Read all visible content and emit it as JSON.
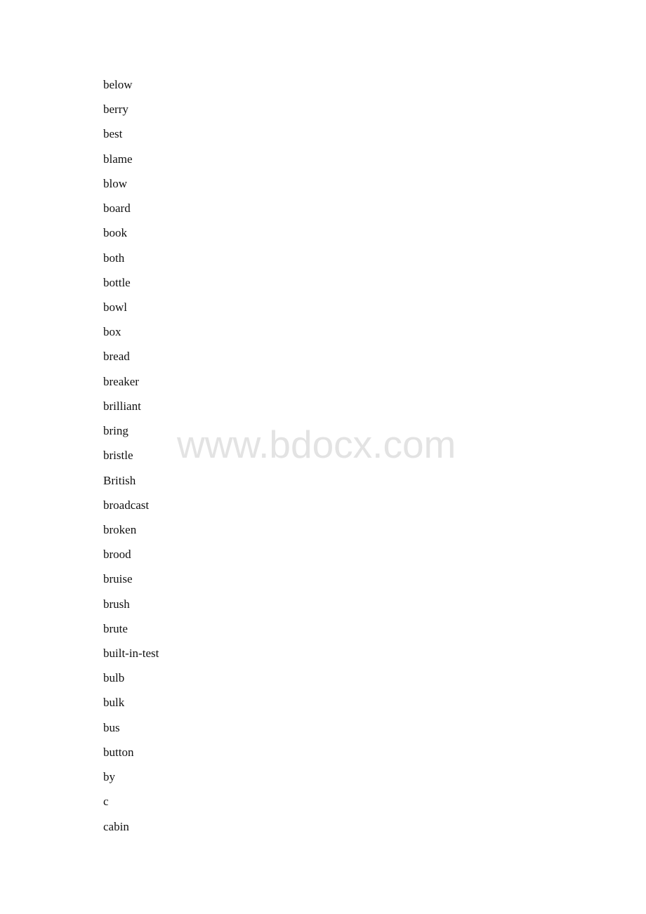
{
  "document": {
    "words": [
      "below",
      "berry",
      "best",
      "blame",
      "blow",
      "board",
      "book",
      "both",
      "bottle",
      "bowl",
      "box",
      "bread",
      "breaker",
      "brilliant",
      "bring",
      "bristle",
      "British",
      "broadcast",
      "broken",
      "brood",
      "bruise",
      "brush",
      "brute",
      "built-in-test",
      "bulb",
      "bulk",
      "bus",
      "button",
      "by",
      "c",
      "cabin"
    ],
    "watermark": "www.bdocx.com"
  }
}
